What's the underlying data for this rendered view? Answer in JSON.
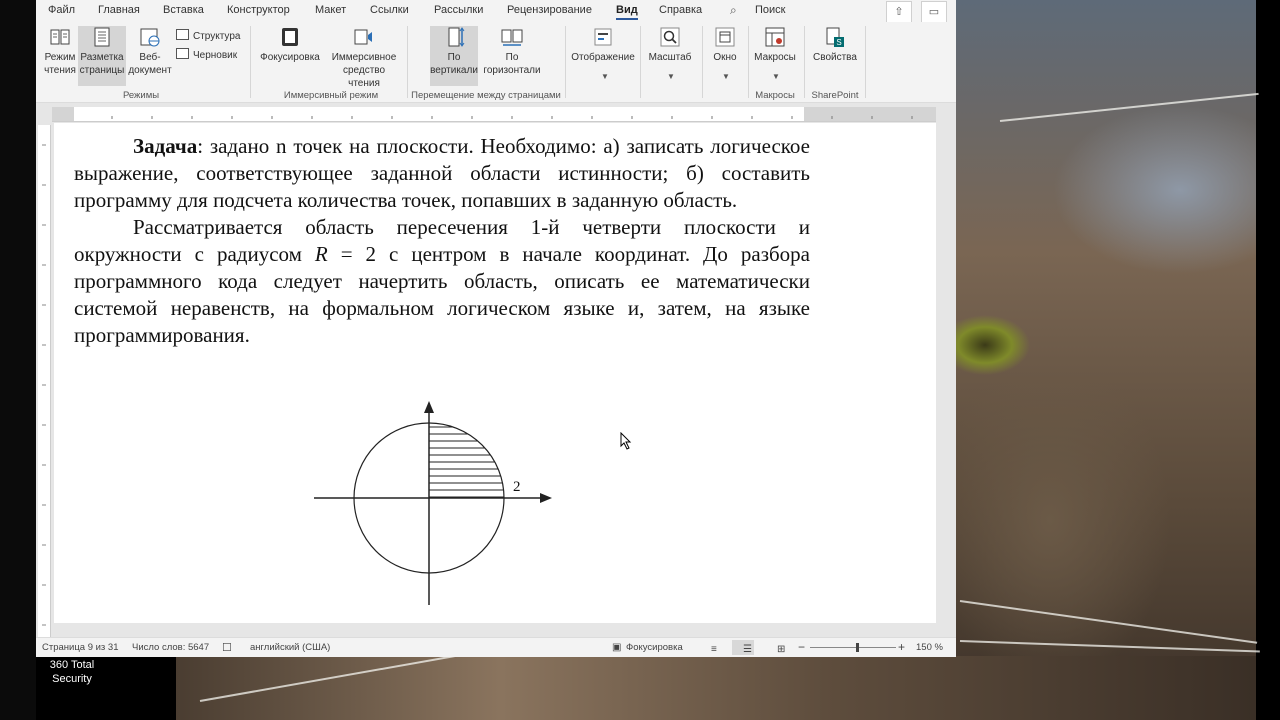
{
  "ribbon_tabs": [
    "Файл",
    "Главная",
    "Вставка",
    "Конструктор",
    "Макет",
    "Ссылки",
    "Рассылки",
    "Рецензирование",
    "Вид",
    "Справка"
  ],
  "active_tab": "Вид",
  "search_label": "Поиск",
  "ribbon": {
    "read_mode": "Режим\nчтения",
    "print_layout": "Разметка\nстраницы",
    "web_layout": "Веб-\nдокумент",
    "outline": "Структура",
    "draft": "Черновик",
    "group_views": "Режимы",
    "focus": "Фокусировка",
    "immersive_reader": "Иммерсивное\nсредство чтения",
    "group_immersive": "Иммерсивный режим",
    "vertical": "По\nвертикали",
    "side_to_side": "По\nгоризонтали",
    "group_page_movement": "Перемещение между страницами",
    "show": "Отображение",
    "zoom": "Масштаб",
    "window": "Окно",
    "macros": "Макросы",
    "group_macros": "Макросы",
    "properties": "Свойства",
    "group_sharepoint": "SharePoint"
  },
  "document": {
    "p1_bold": "Задача",
    "p1_rest": ": задано n точек на плоскости. Необходимо: а) записать логическое выражение, соответствующее заданной области истинности; б) составить программу для подсчета количества точек, попавших в заданную область.",
    "p2_a": "Рассматривается область пересечения 1-й четверти плоскости и окружности с радиусом ",
    "p2_r": "R",
    "p2_b": " = 2 с центром в начале координат. До разбора программного кода следует начертить область, описать ее математически системой неравенств, на формальном логическом языке и, затем, на языке программирования.",
    "figure_label": "2"
  },
  "status": {
    "page": "Страница 9 из 31",
    "words": "Число слов: 5647",
    "language": "английский (США)",
    "focus": "Фокусировка",
    "zoom_out": "−",
    "zoom_in": "+",
    "zoom": "150 %"
  },
  "zoom_fraction": 0.55,
  "taskbar": {
    "app_label": "360 Total\nSecurity"
  }
}
